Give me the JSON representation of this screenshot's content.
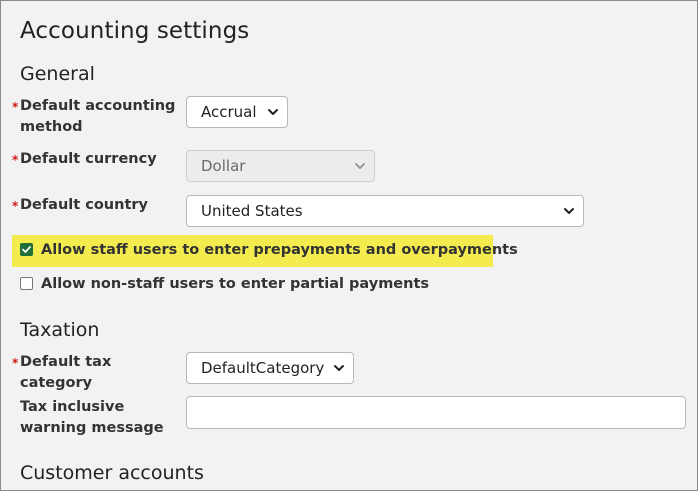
{
  "page": {
    "title": "Accounting settings"
  },
  "general": {
    "heading": "General",
    "accounting_method": {
      "label": "Default accounting method",
      "required_mark": "*",
      "value": "Accrual"
    },
    "currency": {
      "label": "Default currency",
      "required_mark": "*",
      "value": "Dollar",
      "disabled": true
    },
    "country": {
      "label": "Default country",
      "required_mark": "*",
      "value": "United States"
    },
    "prepayments_checkbox": {
      "label": "Allow staff users to enter prepayments and overpayments",
      "checked": true
    },
    "partial_payments_checkbox": {
      "label": "Allow non-staff users to enter partial payments",
      "checked": false
    }
  },
  "taxation": {
    "heading": "Taxation",
    "tax_category": {
      "label": "Default tax category",
      "required_mark": "*",
      "value": "DefaultCategory"
    },
    "tax_warning": {
      "label": "Tax inclusive warning message",
      "value": ""
    }
  },
  "customer_accounts": {
    "heading": "Customer accounts"
  },
  "colors": {
    "highlight": "#f4ec4f",
    "required": "#d11a1a",
    "checkbox_checked": "#1f6f3a"
  },
  "icons": {
    "select_arrow": "chevron-down-icon",
    "checkbox_check": "checkmark-icon"
  }
}
